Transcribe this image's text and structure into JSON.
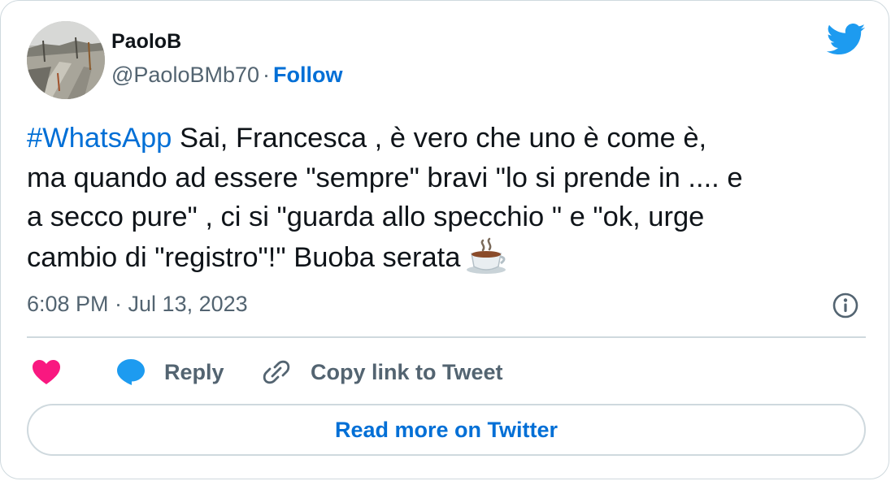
{
  "author": {
    "name": "PaoloB",
    "handle": "@PaoloBMb70",
    "separator": "·",
    "follow_label": "Follow"
  },
  "tweet": {
    "hashtag": "#WhatsApp",
    "lines": [
      " Sai, Francesca , è vero che uno è come è,",
      "ma  quando ad essere \"sempre\" bravi \"lo si prende in .... e",
      "a secco pure\" , ci si \"guarda allo specchio \" e \"ok,  urge",
      "cambio di \"registro\"!\" Buoba serata"
    ],
    "emoji": "hot-beverage-emoji",
    "timestamp": "6:08 PM · Jul 13, 2023"
  },
  "actions": {
    "reply_label": "Reply",
    "copy_link_label": "Copy link to Tweet"
  },
  "footer": {
    "read_more_label": "Read more on Twitter"
  },
  "icons": {
    "brand": "twitter-bird-icon",
    "info": "info-icon",
    "like": "heart-icon",
    "reply": "speech-bubble-icon",
    "copy": "link-icon"
  },
  "colors": {
    "link_blue": "#006fd6",
    "twitter_blue": "#1d9bf0",
    "heart_pink": "#f91880",
    "text_primary": "#0f1419",
    "text_secondary": "#536471",
    "border": "#cfd9de"
  }
}
